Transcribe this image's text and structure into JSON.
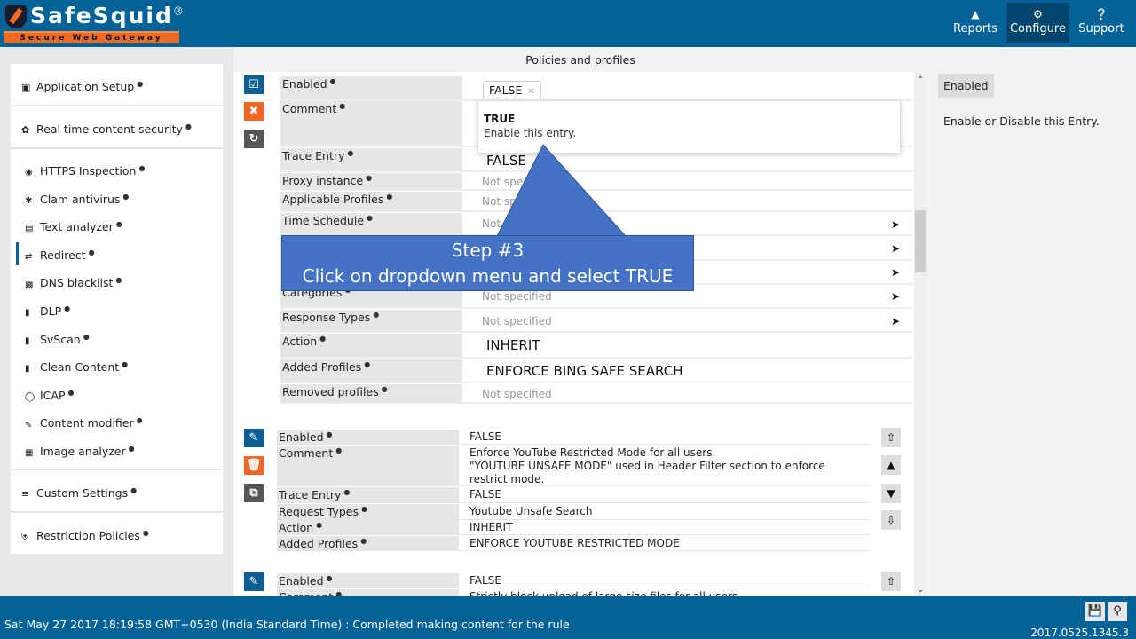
{
  "header": {
    "brand": "SafeSquid",
    "brand_mark": "®",
    "tagline": "Secure Web Gateway",
    "nav": [
      {
        "label": "Reports",
        "icon": "area-chart-icon"
      },
      {
        "label": "Configure",
        "icon": "cogs-icon",
        "active": true
      },
      {
        "label": "Support",
        "icon": "question-circle-icon"
      }
    ]
  },
  "sidebar": {
    "sections": [
      {
        "label": "Application Setup",
        "icon": "briefcase-icon"
      },
      {
        "label": "Real time content security",
        "icon": "bug-icon"
      },
      {
        "label": "Custom Settings",
        "icon": "sliders-icon"
      },
      {
        "label": "Restriction Policies",
        "icon": "shield-icon"
      }
    ],
    "items": [
      {
        "label": "HTTPS Inspection",
        "icon": "eye-icon"
      },
      {
        "label": "Clam antivirus",
        "icon": "asterisk-icon"
      },
      {
        "label": "Text analyzer",
        "icon": "file-word-icon"
      },
      {
        "label": "Redirect",
        "icon": "random-icon",
        "active": true
      },
      {
        "label": "DNS blacklist",
        "icon": "dns-icon"
      },
      {
        "label": "DLP",
        "icon": "barcode-icon"
      },
      {
        "label": "SvScan",
        "icon": "barcode-icon"
      },
      {
        "label": "Clean Content",
        "icon": "barcode-icon"
      },
      {
        "label": "ICAP",
        "icon": "gear-icon"
      },
      {
        "label": "Content modifier",
        "icon": "edit-icon"
      },
      {
        "label": "Image analyzer",
        "icon": "image-icon"
      }
    ]
  },
  "main": {
    "title": "Policies and profiles",
    "editing_entry": {
      "fields": [
        {
          "label": "Enabled",
          "value": "FALSE"
        },
        {
          "label": "Comment",
          "value": ""
        },
        {
          "label": "Trace Entry",
          "value": "FALSE"
        },
        {
          "label": "Proxy instance",
          "value": "Not specified"
        },
        {
          "label": "Applicable Profiles",
          "value": "Not specified"
        },
        {
          "label": "Time Schedule",
          "value": "Not specified"
        },
        {
          "label": "",
          "value": ""
        },
        {
          "label": "",
          "value": ""
        },
        {
          "label": "",
          "value": ""
        },
        {
          "label": "Categories",
          "value": "Not specified"
        },
        {
          "label": "Response Types",
          "value": "Not specified"
        },
        {
          "label": "Action",
          "value": "INHERIT"
        },
        {
          "label": "Added Profiles",
          "value": "ENFORCE BING SAFE SEARCH"
        },
        {
          "label": "Removed profiles",
          "value": "Not specified"
        }
      ],
      "dropdown": {
        "option_title": "TRUE",
        "option_desc": "Enable this entry."
      }
    },
    "entry2": {
      "fields": [
        {
          "label": "Enabled",
          "value": "FALSE"
        },
        {
          "label": "Comment",
          "value": "Enforce YouTube Restricted Mode for all users.\n\"YOUTUBE UNSAFE MODE\" used in Header Filter section to enforce restrict mode."
        },
        {
          "label": "Trace Entry",
          "value": "FALSE"
        },
        {
          "label": "Request Types",
          "value": "Youtube Unsafe Search"
        },
        {
          "label": "Action",
          "value": "INHERIT"
        },
        {
          "label": "Added Profiles",
          "value": "ENFORCE YOUTUBE RESTRICTED MODE"
        }
      ]
    },
    "entry3": {
      "fields": [
        {
          "label": "Enabled",
          "value": "FALSE"
        },
        {
          "label": "Comment",
          "value": "Strictly block upload of large size files for all users."
        }
      ]
    }
  },
  "help": {
    "tag": "Enabled",
    "description": "Enable or Disable this Entry."
  },
  "callout": {
    "line1": "Step #3",
    "line2": "Click on dropdown menu and select TRUE"
  },
  "footer": {
    "status": "Sat May 27 2017 18:19:58 GMT+0530 (India Standard Time) : Completed making content for the rule",
    "version": "2017.0525.1345.3"
  }
}
